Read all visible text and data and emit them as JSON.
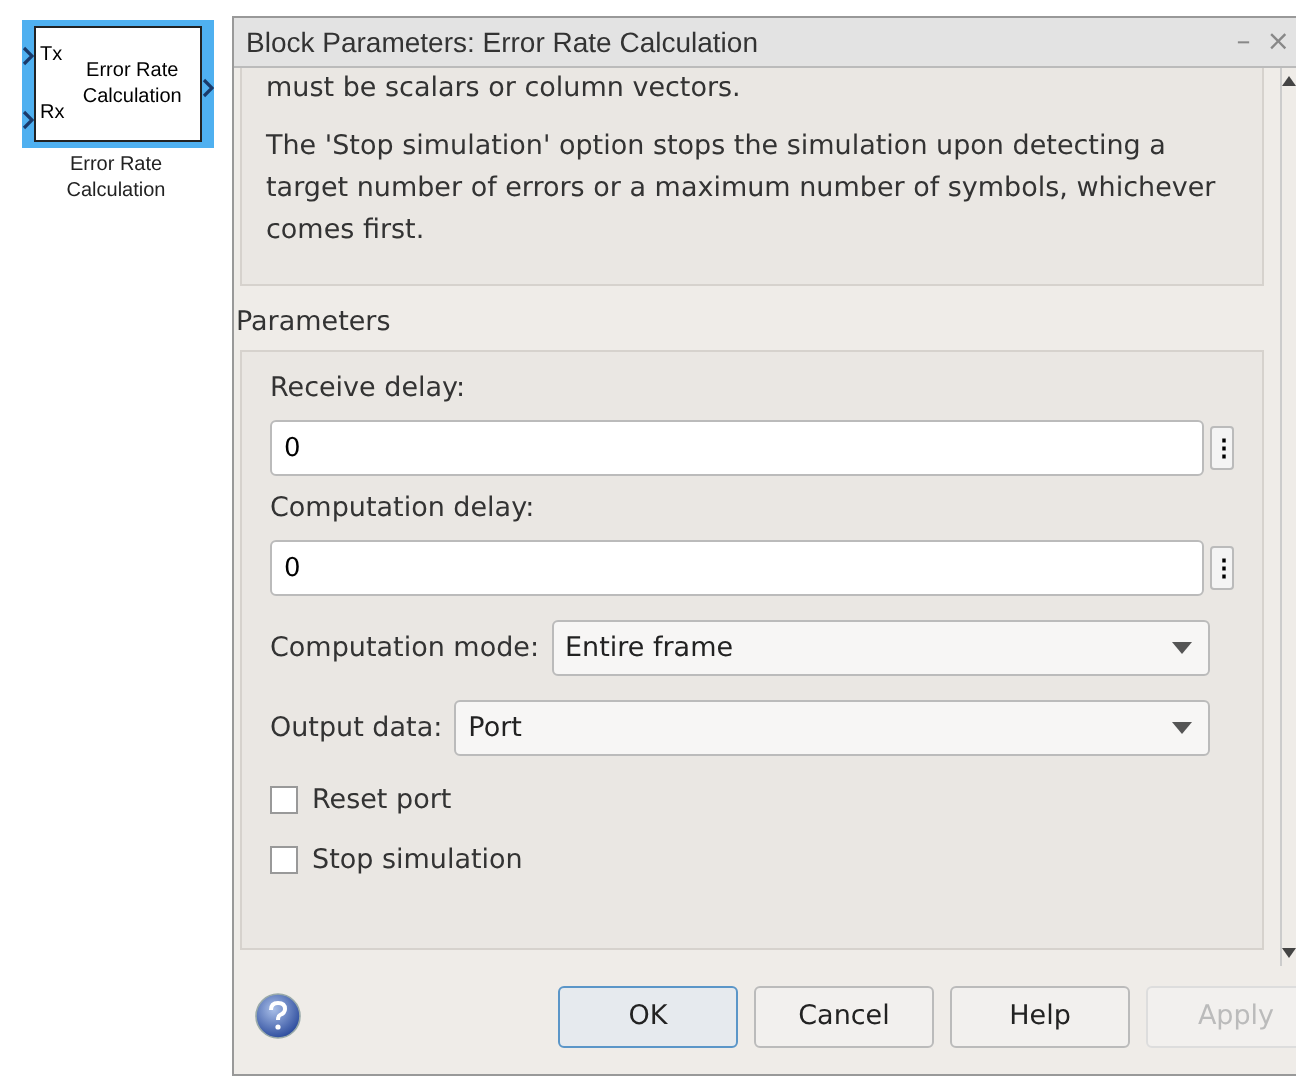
{
  "block": {
    "inputs": [
      "Tx",
      "Rx"
    ],
    "title": "Error Rate Calculation",
    "caption": "Error Rate Calculation",
    "selected": true
  },
  "dialog": {
    "title": "Block Parameters: Error Rate Calculation",
    "minimize": "–",
    "close": "×",
    "description": [
      "must be scalars or column vectors.",
      "The 'Stop simulation' option stops the simulation upon detecting a target number of errors or a maximum number of symbols, whichever comes first."
    ],
    "section": "Parameters",
    "parameters": [
      {
        "kind": "edit",
        "label": "Receive delay:",
        "value": "0",
        "more": "⋮"
      },
      {
        "kind": "edit",
        "label": "Computation delay:",
        "value": "0",
        "more": "⋮"
      },
      {
        "kind": "popup",
        "label": "Computation mode:",
        "value": "Entire frame"
      },
      {
        "kind": "popup",
        "label": "Output data:",
        "value": "Port"
      },
      {
        "kind": "check",
        "label": "Reset port",
        "checked": false
      },
      {
        "kind": "check",
        "label": "Stop simulation",
        "checked": false
      }
    ],
    "buttons": [
      {
        "label": "OK",
        "default": true,
        "disabled": false
      },
      {
        "label": "Cancel",
        "default": false,
        "disabled": false
      },
      {
        "label": "Help",
        "default": false,
        "disabled": false
      },
      {
        "label": "Apply",
        "default": false,
        "disabled": true
      }
    ]
  }
}
